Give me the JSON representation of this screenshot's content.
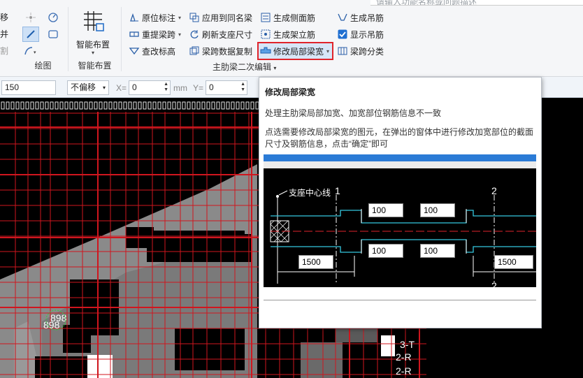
{
  "search": {
    "placeholder": "请输入功能名称或问题描述"
  },
  "left_stub": {
    "items": [
      "移",
      "并",
      "割"
    ]
  },
  "draw_group": {
    "label": "绘图"
  },
  "smart_group": {
    "button_label": "智能布置",
    "label": "智能布置"
  },
  "beam_group": {
    "label": "主肋梁二次编辑",
    "col1": [
      "原位标注",
      "重提梁跨",
      "查改标高"
    ],
    "col2": [
      "应用到同名梁",
      "刷新支座尺寸",
      "梁跨数据复制"
    ],
    "col3": [
      "生成侧面筋",
      "生成架立筋",
      "修改局部梁宽"
    ],
    "col4": [
      "生成吊筋",
      "显示吊筋",
      "梁跨分类"
    ]
  },
  "toolbar": {
    "value": "150",
    "offset_mode": "不偏移",
    "x_label": "X=",
    "x_value": "0",
    "y_label": "Y=",
    "y_value": "0",
    "unit": "mm"
  },
  "canvas": {
    "labels": [
      "898",
      "898",
      "3-T",
      "2-R",
      "2-R"
    ]
  },
  "tooltip": {
    "title": "修改局部梁宽",
    "desc1": "处理主肋梁局部加宽、加宽部位钢筋信息不一致",
    "desc2": "点选需要修改局部梁宽的图元，在弹出的窗体中进行修改加宽部位的截面尺寸及钢筋信息，点击“确定”即可",
    "diagram": {
      "support_label": "支座中心线",
      "axis1": "1",
      "axis2": "2",
      "axis2b": "2",
      "dims": [
        "100",
        "100",
        "100",
        "100",
        "1500",
        "1500"
      ]
    }
  },
  "colors": {
    "highlight": "#e0242b",
    "grid_red": "#d0161e",
    "cyan": "#35c8e0"
  }
}
